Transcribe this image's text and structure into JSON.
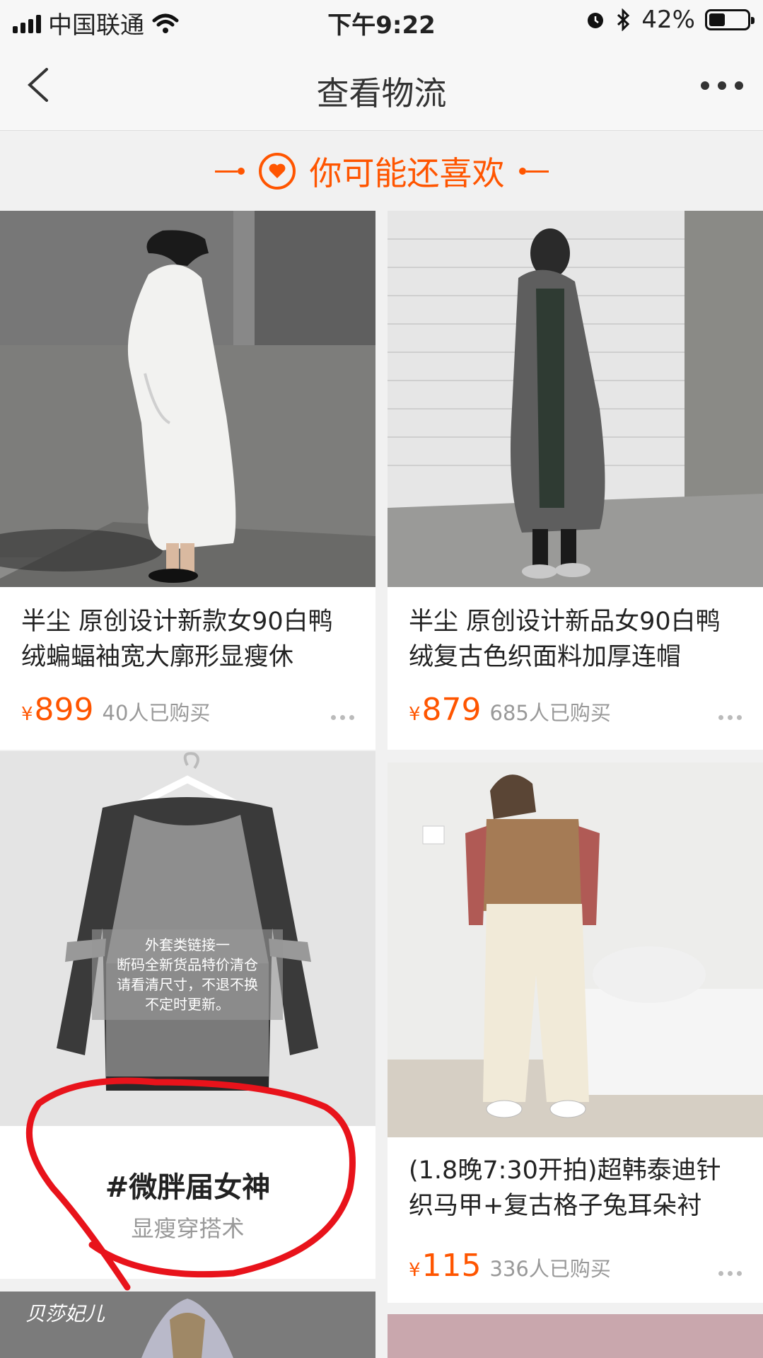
{
  "status_bar": {
    "carrier": "中国联通",
    "time": "下午9:22",
    "battery_percent": "42%",
    "battery_level": 0.42
  },
  "nav": {
    "title": "查看物流"
  },
  "recommend": {
    "header": "你可能还喜欢"
  },
  "products": [
    {
      "title": "半尘 原创设计新款女90白鸭绒蝙蝠袖宽大廓形显瘦休",
      "currency": "¥",
      "price": "899",
      "sold": "40人已购买"
    },
    {
      "title": "半尘 原创设计新品女90白鸭绒复古色织面料加厚连帽",
      "currency": "¥",
      "price": "879",
      "sold": "685人已购买"
    },
    {
      "title": "(1.8晚7:30开拍)超韩泰迪针织马甲+复古格子兔耳朵衬",
      "currency": "¥",
      "price": "115",
      "sold": "336人已购买"
    }
  ],
  "promo": {
    "title": "#微胖届女神",
    "subtitle": "显瘦穿搭术",
    "image_text": [
      "外套类链接一",
      "断码全新货品特价清仓",
      "请看清尺寸，不退不换",
      "不定时更新。"
    ]
  },
  "next_card": {
    "brand": "贝莎妃儿"
  },
  "colors": {
    "accent": "#ff5500",
    "annotation": "#e8131b"
  }
}
